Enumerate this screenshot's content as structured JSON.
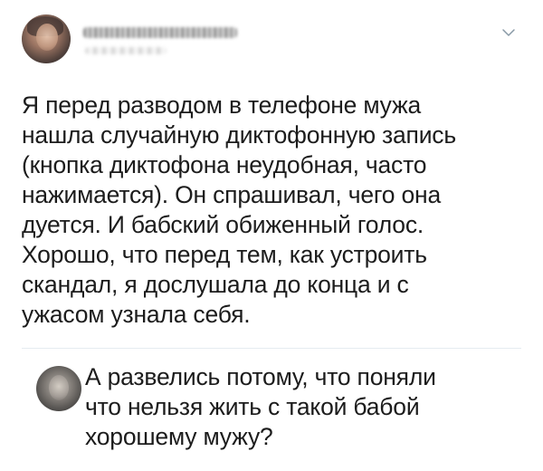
{
  "tweet": {
    "text": "Я перед разводом в телефоне мужа\nнашла случайную диктофонную запись\n(кнопка диктофона неудобная, часто\nнажимается). Он спрашивал, чего она\nдуется. И бабский обиженный голос.\nХорошо, что перед тем, как устроить\nскандал, я дослушала до конца и с\nужасом узнала себя."
  },
  "reply": {
    "text": "А развелись потому, что поняли\nчто нельзя жить с такой бабой\nхорошему мужу?"
  },
  "icons": {
    "menu": "chevron-down-icon"
  },
  "colors": {
    "text": "#1c1c1c",
    "divider": "#e6ecf0",
    "chevron": "#8899a6"
  }
}
